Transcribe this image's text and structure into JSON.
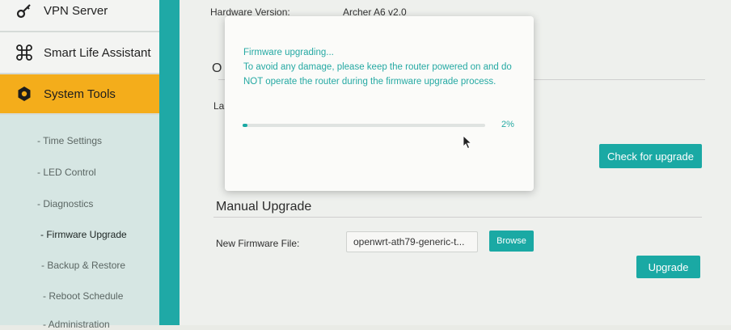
{
  "sidebar": {
    "items": [
      {
        "label": "VPN Server",
        "icon": "key-icon"
      },
      {
        "label": "Smart Life Assistant",
        "icon": "command-icon"
      },
      {
        "label": "System Tools",
        "icon": "gear-icon"
      }
    ],
    "sub_items": [
      {
        "label": "- Time Settings"
      },
      {
        "label": "- LED Control"
      },
      {
        "label": "- Diagnostics"
      },
      {
        "label": "- Firmware Upgrade"
      },
      {
        "label": "- Backup & Restore"
      },
      {
        "label": "- Reboot Schedule"
      },
      {
        "label": "- Administration"
      }
    ]
  },
  "main": {
    "hardware_label": "Hardware Version:",
    "hardware_value": "Archer A6 v2.0",
    "online_partial": "O",
    "latest_partial": "La",
    "check_button": "Check for upgrade",
    "manual_title": "Manual Upgrade",
    "firmware_file_label": "New Firmware File:",
    "firmware_file_value": "openwrt-ath79-generic-t...",
    "browse_button": "Browse",
    "upgrade_button": "Upgrade"
  },
  "modal": {
    "line1": "Firmware upgrading...",
    "line2": "To avoid any damage, please keep the router powered on and do NOT operate the router during the firmware upgrade process.",
    "progress_text": "2%",
    "progress_value": 0.02
  },
  "colors": {
    "accent": "#1aa9a4",
    "active_menu": "#f4ad1b"
  }
}
